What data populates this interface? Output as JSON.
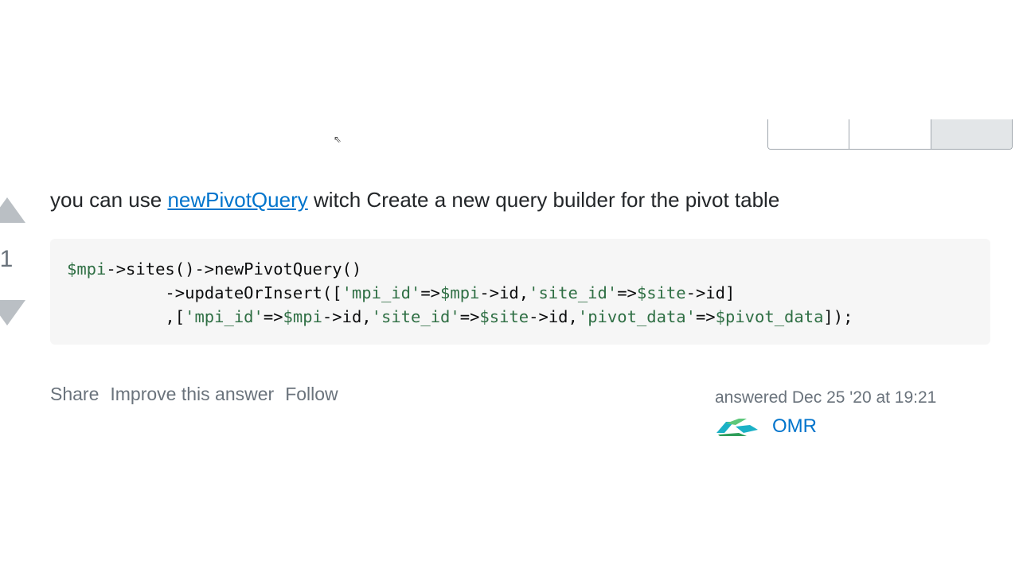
{
  "cursor_glyph": "⇖",
  "vote": {
    "count": "1"
  },
  "answer": {
    "text_before": "you can use ",
    "link_text": "newPivotQuery",
    "text_after": " witch Create a new query builder for the pivot table"
  },
  "code": {
    "lines": [
      [
        [
          "var",
          "$mpi"
        ],
        [
          "plain",
          "->sites()->newPivotQuery()"
        ]
      ],
      [
        [
          "plain",
          "          ->updateOrInsert(["
        ],
        [
          "str",
          "'mpi_id'"
        ],
        [
          "plain",
          "=>"
        ],
        [
          "var",
          "$mpi"
        ],
        [
          "plain",
          "->id,"
        ],
        [
          "str",
          "'site_id'"
        ],
        [
          "plain",
          "=>"
        ],
        [
          "var",
          "$site"
        ],
        [
          "plain",
          "->id]"
        ]
      ],
      [
        [
          "plain",
          "          ,["
        ],
        [
          "str",
          "'mpi_id'"
        ],
        [
          "plain",
          "=>"
        ],
        [
          "var",
          "$mpi"
        ],
        [
          "plain",
          "->id,"
        ],
        [
          "str",
          "'site_id'"
        ],
        [
          "plain",
          "=>"
        ],
        [
          "var",
          "$site"
        ],
        [
          "plain",
          "->id,"
        ],
        [
          "str",
          "'pivot_data'"
        ],
        [
          "plain",
          "=>"
        ],
        [
          "var",
          "$pivot_data"
        ],
        [
          "plain",
          "]);"
        ]
      ]
    ]
  },
  "post_menu": {
    "share": "Share",
    "improve": "Improve this answer",
    "follow": "Follow"
  },
  "signature": {
    "action_time": "answered Dec 25 '20 at 19:21",
    "user_name": "OMR"
  },
  "colors": {
    "link": "#0074cc",
    "vote_arrow": "#babfc4",
    "code_bg": "#f6f6f6",
    "code_token": "#2f6f44"
  }
}
